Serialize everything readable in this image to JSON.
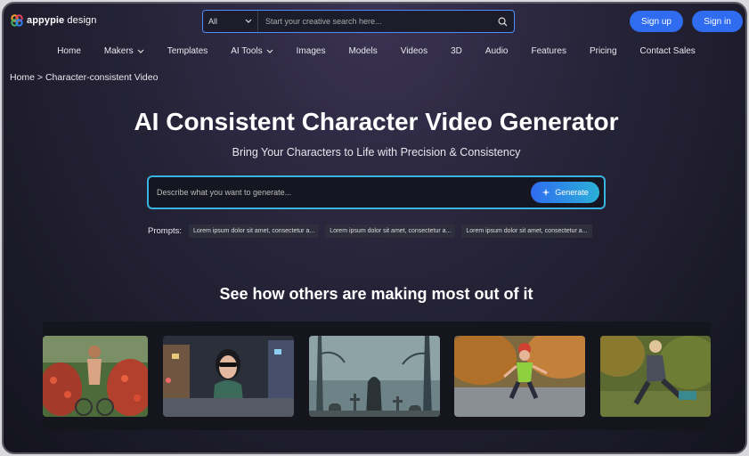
{
  "header": {
    "logo_bold": "appypie",
    "logo_light": " design",
    "search": {
      "category": "All",
      "placeholder": "Start your creative search here..."
    },
    "signup_label": "Sign up",
    "signin_label": "Sign in"
  },
  "nav": {
    "items": [
      {
        "label": "Home",
        "dropdown": false
      },
      {
        "label": "Makers",
        "dropdown": true
      },
      {
        "label": "Templates",
        "dropdown": false
      },
      {
        "label": "AI Tools",
        "dropdown": true
      },
      {
        "label": "Images",
        "dropdown": false
      },
      {
        "label": "Models",
        "dropdown": false
      },
      {
        "label": "Videos",
        "dropdown": false
      },
      {
        "label": "3D",
        "dropdown": false
      },
      {
        "label": "Audio",
        "dropdown": false
      },
      {
        "label": "Features",
        "dropdown": false
      },
      {
        "label": "Pricing",
        "dropdown": false
      },
      {
        "label": "Contact Sales",
        "dropdown": false
      }
    ]
  },
  "breadcrumb": "Home > Character-consistent Video",
  "hero": {
    "title": "AI Consistent Character Video Generator",
    "subtitle": "Bring Your Characters to Life with Precision & Consistency",
    "prompt_placeholder": "Describe what you want to generate...",
    "generate_label": "Generate"
  },
  "prompts": {
    "label": "Prompts:",
    "chips": [
      "Lorem ipsum dolor sit amet, consectetur a...",
      "Lorem ipsum dolor sit amet, consectetur a...",
      "Lorem ipsum dolor sit amet, consectetur a..."
    ]
  },
  "section_title": "See how others are making most out of it",
  "colors": {
    "accent": "#2f6cf0",
    "cyan": "#39b3e0"
  },
  "gallery_icons": [
    "girl-on-bicycle-image",
    "woman-in-sunglasses-image",
    "graveyard-image",
    "child-skating-image",
    "girl-running-image"
  ]
}
